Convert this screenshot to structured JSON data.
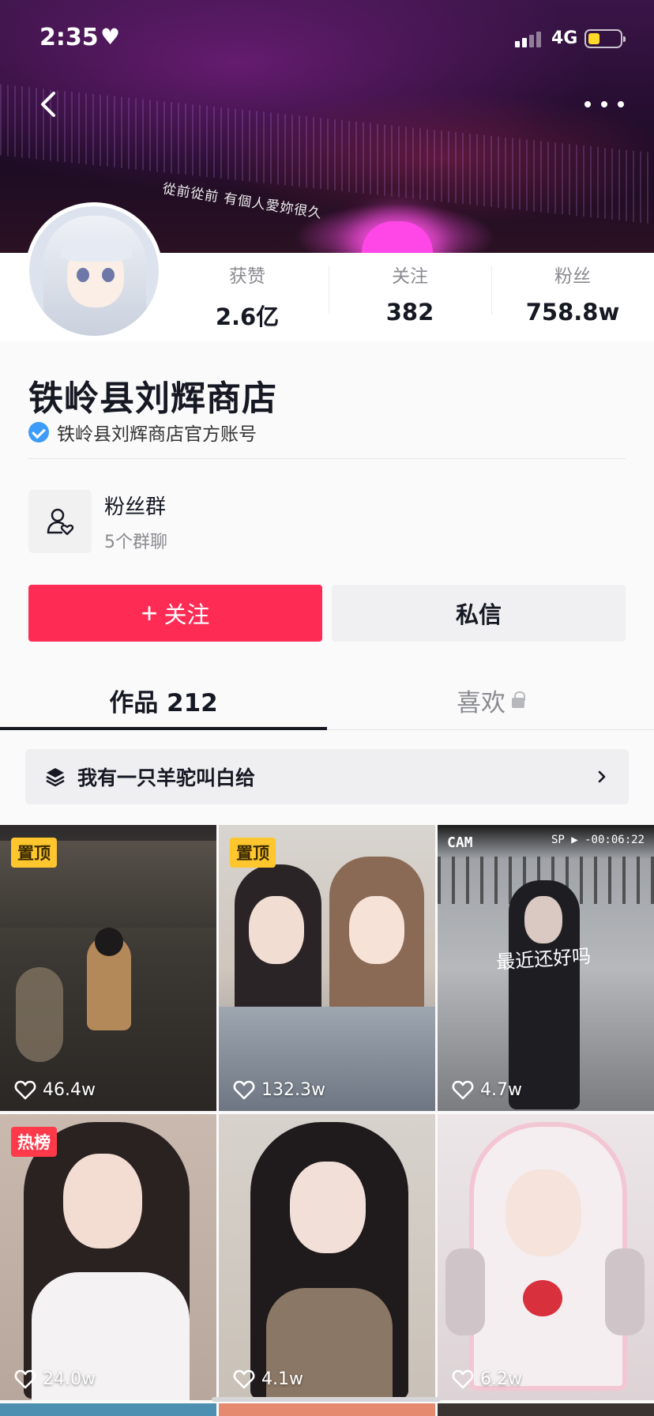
{
  "status_bar": {
    "time": "2:35",
    "network": "4G"
  },
  "cover": {
    "banner_text": "從前從前 有個人愛妳很久"
  },
  "profile": {
    "name": "铁岭县刘辉商店",
    "verified_text": "铁岭县刘辉商店官方账号",
    "stats": [
      {
        "label": "获赞",
        "value": "2.6亿"
      },
      {
        "label": "关注",
        "value": "382"
      },
      {
        "label": "粉丝",
        "value": "758.8w"
      }
    ]
  },
  "fan_group": {
    "title": "粉丝群",
    "subtitle": "5个群聊"
  },
  "actions": {
    "follow_label": "关注",
    "follow_plus": "+",
    "message_label": "私信"
  },
  "tabs": {
    "works": "作品 212",
    "likes": "喜欢"
  },
  "collection": {
    "label": "我有一只羊驼叫白给"
  },
  "grid": {
    "items": [
      {
        "badge": "置顶",
        "likes": "46.4w"
      },
      {
        "badge": "置顶",
        "likes": "132.3w"
      },
      {
        "badge": "",
        "likes": "4.7w",
        "cam": "CAM",
        "cam_time": "SP ▶ -00:06:22",
        "caption": "最近还好吗"
      },
      {
        "badge": "热榜",
        "likes": "24.0w"
      },
      {
        "badge": "",
        "likes": "4.1w"
      },
      {
        "badge": "",
        "likes": "6.2w"
      }
    ]
  },
  "colors": {
    "accent": "#fe2c55",
    "pin_badge": "#ffc62d",
    "hot_badge": "#fe3a4a",
    "verified": "#3c9cf8"
  }
}
